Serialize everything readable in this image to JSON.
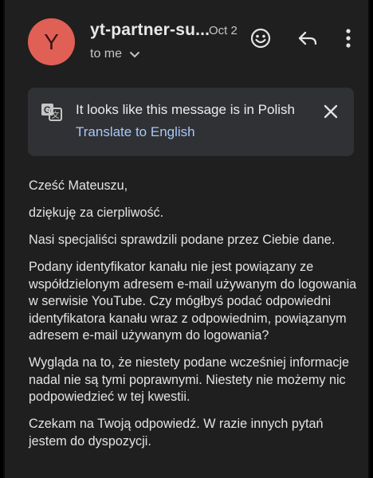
{
  "header": {
    "avatar_letter": "Y",
    "sender": "yt-partner-su...",
    "date": "Oct 2",
    "recipient_label": "to me"
  },
  "icons": {
    "emoji": "emoji-icon",
    "reply": "reply-icon",
    "more": "more-vert-icon",
    "translate": "translate-icon",
    "close": "close-icon",
    "chevron": "chevron-down-icon"
  },
  "translate_banner": {
    "message": "It looks like this message is in Polish",
    "action": "Translate to English"
  },
  "body": {
    "paragraphs": [
      "Cześć Mateuszu,",
      "dziękuję za cierpliwość.",
      "Nasi specjaliści sprawdzili podane przez Ciebie dane.",
      "Podany identyfikator kanału nie jest powiązany ze współdzielonym adresem e-mail używanym do logowania w serwisie YouTube. Czy mógłbyś podać odpowiedni identyfikatora kanału wraz z odpowiednim, powiązanym adresem e-mail używanym do logowania?",
      "Wygląda na to, że niestety podane wcześniej informacje nadal nie są tymi poprawnymi. Niestety nie możemy nic podpowiedzieć w tej kwestii.",
      "Czekam na Twoją odpowiedź. W razie innych pytań jestem do dyspozycji."
    ]
  },
  "colors": {
    "background": "#1f1f1f",
    "avatar": "#e06055",
    "banner": "#303134",
    "link": "#a8c7fa",
    "text": "#e3e3e3"
  }
}
